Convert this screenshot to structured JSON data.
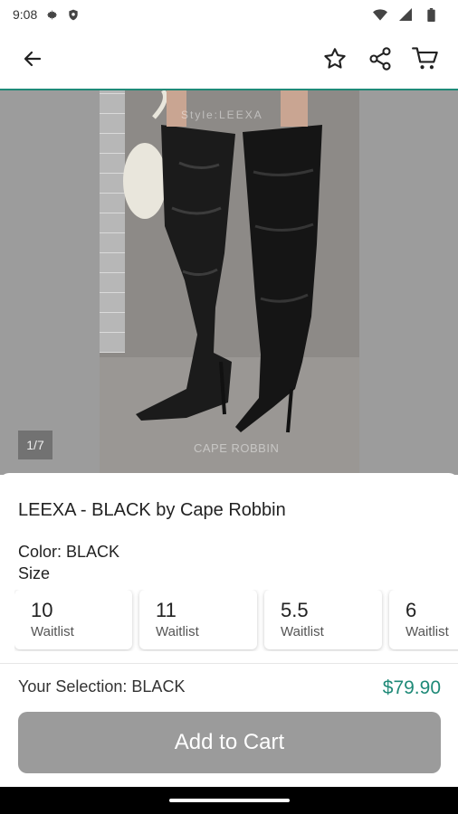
{
  "status_bar": {
    "time": "9:08",
    "icons": [
      "gear-icon",
      "shield-icon",
      "wifi-icon",
      "signal-icon",
      "battery-icon"
    ]
  },
  "app_bar": {
    "icons": [
      "arrow-left-icon",
      "star-icon",
      "share-icon",
      "cart-icon"
    ],
    "accent_color": "#1f8a78"
  },
  "gallery": {
    "counter": "1/7",
    "watermark_top": "Style:LEEXA",
    "watermark_bottom": "CAPE ROBBIN"
  },
  "product": {
    "title": "LEEXA - BLACK by Cape Robbin",
    "color_line": "Color: BLACK",
    "size_label": "Size",
    "sizes": [
      {
        "size": "10",
        "status": "Waitlist"
      },
      {
        "size": "11",
        "status": "Waitlist"
      },
      {
        "size": "5.5",
        "status": "Waitlist"
      },
      {
        "size": "6",
        "status": "Waitlist"
      }
    ],
    "selection": "Your Selection: BLACK",
    "price": "$79.90",
    "price_color": "#1f8a78",
    "add_to_cart": "Add to Cart"
  }
}
